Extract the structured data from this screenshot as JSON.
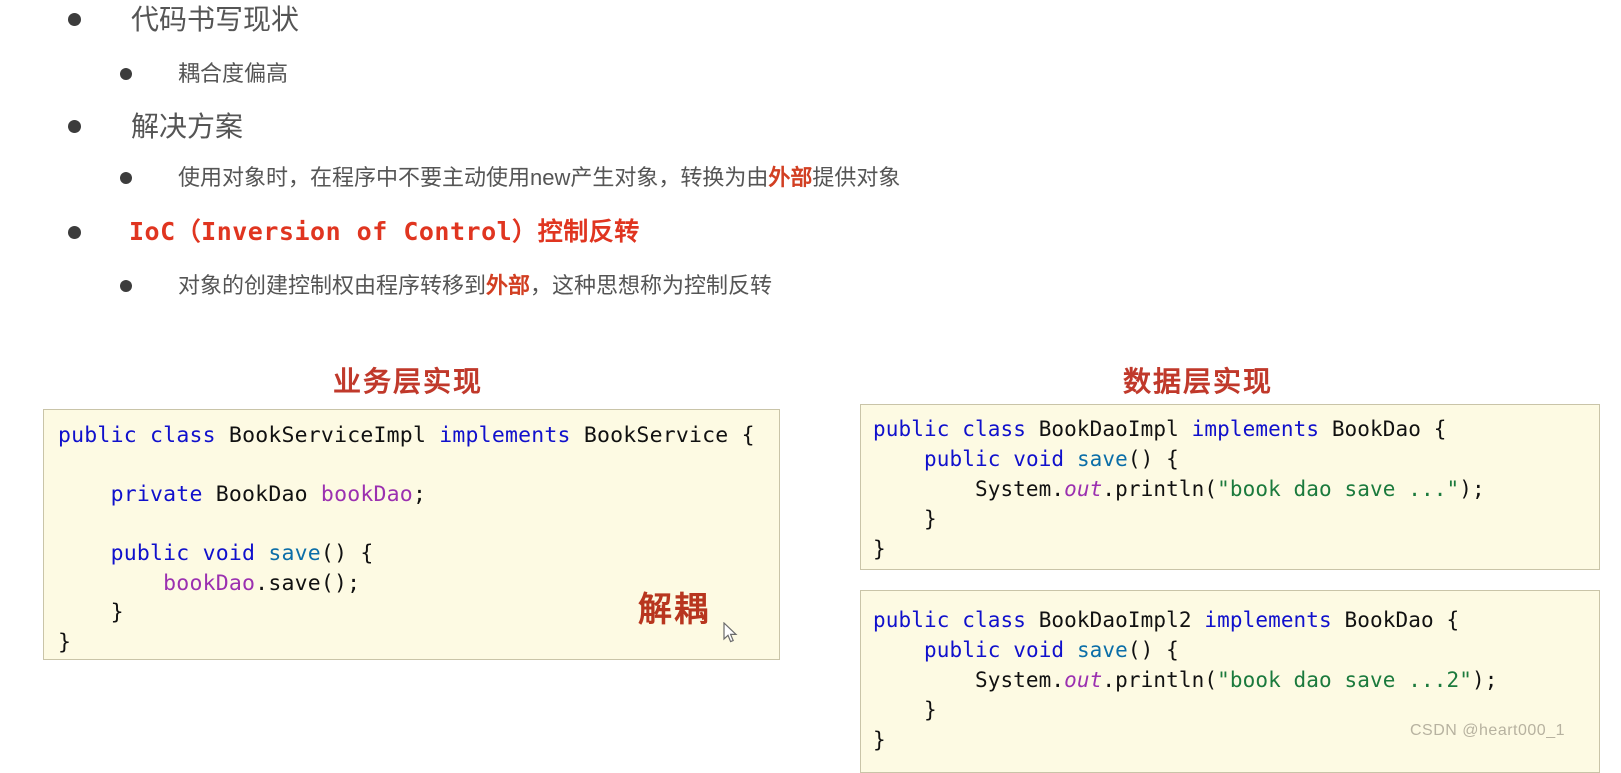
{
  "outline": {
    "items": [
      {
        "level": 1,
        "text": "代码书写现状"
      },
      {
        "level": 2,
        "text": "耦合度偏高"
      },
      {
        "level": 1,
        "text": "解决方案"
      },
      {
        "level": 2,
        "text_before": "使用对象时，在程序中不要主动使用new产生对象，转换为由",
        "highlight": "外部",
        "text_after": "提供对象"
      },
      {
        "level": 1,
        "ioc_mono": "IoC（Inversion of Control）",
        "ioc_cjk": "控制反转"
      },
      {
        "level": 2,
        "text_before": "对象的创建控制权由程序转移到",
        "highlight": "外部",
        "text_after": "，这种思想称为控制反转"
      }
    ]
  },
  "sections": {
    "service_title": "业务层实现",
    "dao_title": "数据层实现"
  },
  "code": {
    "service": {
      "line1_kw1": "public",
      "line1_kw2": "class",
      "line1_name": "BookServiceImpl",
      "line1_kw3": "implements",
      "line1_iface": "BookService",
      "line1_brace": "{",
      "line3_kw": "private",
      "line3_type": "BookDao",
      "line3_var": "bookDao",
      "line3_semi": ";",
      "line5_kw1": "public",
      "line5_kw2": "void",
      "line5_method": "save",
      "line5_rest": "() {",
      "line6_var": "bookDao",
      "line6_rest": ".save();",
      "line7": "}",
      "line8": "}"
    },
    "dao1": {
      "line1_kw1": "public",
      "line1_kw2": "class",
      "line1_name": "BookDaoImpl",
      "line1_kw3": "implements",
      "line1_iface": "BookDao",
      "line1_brace": "{",
      "line2_kw1": "public",
      "line2_kw2": "void",
      "line2_method": "save",
      "line2_rest": "() {",
      "line3_sys": "System.",
      "line3_out": "out",
      "line3_println": ".println(",
      "line3_str": "\"book dao save ...\"",
      "line3_end": ");",
      "line4": "}",
      "line5": "}"
    },
    "dao2": {
      "line1_kw1": "public",
      "line1_kw2": "class",
      "line1_name": "BookDaoImpl2",
      "line1_kw3": "implements",
      "line1_iface": "BookDao",
      "line1_brace": "{",
      "line2_kw1": "public",
      "line2_kw2": "void",
      "line2_method": "save",
      "line2_rest": "() {",
      "line3_sys": "System.",
      "line3_out": "out",
      "line3_println": ".println(",
      "line3_str": "\"book dao save ...2\"",
      "line3_end": ");",
      "line4": "}",
      "line5": "}"
    }
  },
  "annotations": {
    "decouple": "解耦"
  },
  "watermark": {
    "text": "CSDN @heart000_1"
  },
  "colors": {
    "accent_red": "#d23f22",
    "ioc_red": "#e03520",
    "heading_red": "#c0392b",
    "code_bg": "#fdfae3",
    "code_border": "#c9c4a8",
    "body_text": "#555555"
  }
}
